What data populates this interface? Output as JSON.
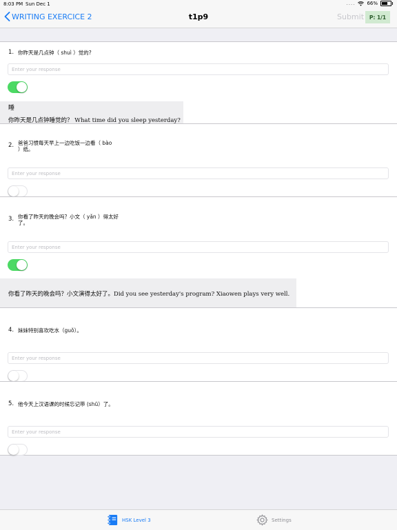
{
  "status": {
    "time": "8:03 PM",
    "date": "Sun Dec 1",
    "signal": "....",
    "battery": "66%",
    "battery_level": 0.66
  },
  "nav": {
    "back_label": "WRITING EXERCICE 2",
    "title": "t1p9",
    "submit_label": "Submit",
    "page_badge": "P: 1/1"
  },
  "questions": [
    {
      "number": "1.",
      "text": "你昨天是几点钟（ shuì ）觉的?",
      "placeholder": "Enter your response",
      "toggle_on": true,
      "answer_word": "睡",
      "answer_sentence": "你昨天是几点钟睡觉的？ What time did you sleep yesterday?"
    },
    {
      "number": "2.",
      "text": "爸爸习惯每天早上一边吃饭一边看（ bào ）纸。",
      "placeholder": "Enter your response",
      "toggle_on": false
    },
    {
      "number": "3.",
      "text": "你看了昨天的晚会吗？小文（ yǎn ）得太好了。",
      "placeholder": "Enter your response",
      "toggle_on": true,
      "answer_sentence": "你看了昨天的晚会吗？小文演得太好了。Did you see yesterday's program? Xiaowen plays very well."
    },
    {
      "number": "4.",
      "text": "妹妹特别喜欢吃水（guǒ）。",
      "placeholder": "Enter your response",
      "toggle_on": false
    },
    {
      "number": "5.",
      "text": "他今天上汉语课的时候忘记带 (shū）了。",
      "placeholder": "Enter your response",
      "toggle_on": false
    }
  ],
  "tabs": [
    {
      "label": "HSK Level 3",
      "icon": "notebook-icon",
      "active": true
    },
    {
      "label": "Settings",
      "icon": "gear-icon",
      "active": false
    }
  ],
  "colors": {
    "accent": "#1a7cf5",
    "toggle_on": "#4cd964",
    "badge_bg": "#d1ead1"
  }
}
